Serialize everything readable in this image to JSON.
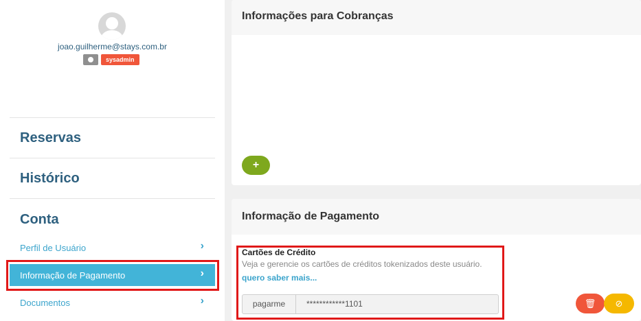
{
  "user": {
    "email": "joao.guilherme@stays.com.br",
    "role": "sysadmin"
  },
  "nav": {
    "reservas": "Reservas",
    "historico": "Histórico",
    "conta": "Conta",
    "items": [
      {
        "label": "Perfil de Usuário",
        "active": false
      },
      {
        "label": "Informação de Pagamento",
        "active": true
      },
      {
        "label": "Documentos",
        "active": false
      }
    ],
    "chevron": "›"
  },
  "billing": {
    "title": "Informações para Cobranças",
    "add_label": "+"
  },
  "payment": {
    "title": "Informação de Pagamento",
    "cards_title": "Cartões de Crédito",
    "cards_desc": "Veja e gerencie os cartões de créditos tokenizados deste usuário.",
    "learn_more": "quero saber mais...",
    "card": {
      "provider": "pagarme",
      "number": "************1101"
    },
    "delete_icon": "🗑",
    "block_icon": "⊘"
  },
  "colors": {
    "accent": "#42b4d8",
    "nav_heading": "#2e607f",
    "danger": "#f0563a",
    "warning": "#f5b800",
    "success": "#7ea81e",
    "highlight_border": "#e01818"
  }
}
